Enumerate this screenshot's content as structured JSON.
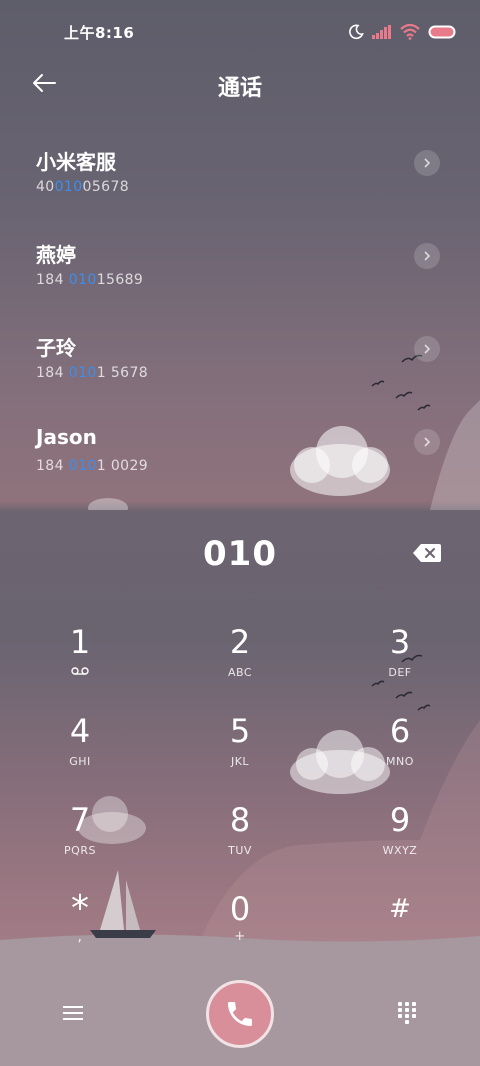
{
  "status_bar": {
    "time": "上午8:16"
  },
  "header": {
    "title": "通话"
  },
  "results": [
    {
      "name": "小米客服",
      "num_pre": "40",
      "num_hl": "010",
      "num_post": "05678"
    },
    {
      "name": "燕婷",
      "num_pre": "184 ",
      "num_hl": "010",
      "num_post": "15689"
    },
    {
      "name": "子玲",
      "num_pre": "184 ",
      "num_hl": "010",
      "num_post": "1 5678"
    },
    {
      "name": "Jason",
      "num_pre": "184 ",
      "num_hl": "010",
      "num_post": "1 0029"
    }
  ],
  "dialer": {
    "input": "010",
    "keys": [
      {
        "digit": "1",
        "letters": ""
      },
      {
        "digit": "2",
        "letters": "ABC"
      },
      {
        "digit": "3",
        "letters": "DEF"
      },
      {
        "digit": "4",
        "letters": "GHI"
      },
      {
        "digit": "5",
        "letters": "JKL"
      },
      {
        "digit": "6",
        "letters": "MNO"
      },
      {
        "digit": "7",
        "letters": "PQRS"
      },
      {
        "digit": "8",
        "letters": "TUV"
      },
      {
        "digit": "9",
        "letters": "WXYZ"
      },
      {
        "digit": "*",
        "letters": ","
      },
      {
        "digit": "0",
        "letters": "+"
      },
      {
        "digit": "#",
        "letters": ""
      }
    ]
  },
  "icons": {
    "back": "back-arrow-icon",
    "moon": "moon-icon",
    "signal": "signal-icon",
    "wifi": "wifi-icon",
    "battery": "battery-icon",
    "chevron": "chevron-right-icon",
    "backspace": "backspace-icon",
    "voicemail": "voicemail-icon",
    "menu": "menu-icon",
    "call": "phone-icon",
    "dialpad": "dialpad-icon"
  },
  "colors": {
    "highlight": "#3a8ef0",
    "call_button": "#d98f9a",
    "battery": "#e87a8a"
  }
}
